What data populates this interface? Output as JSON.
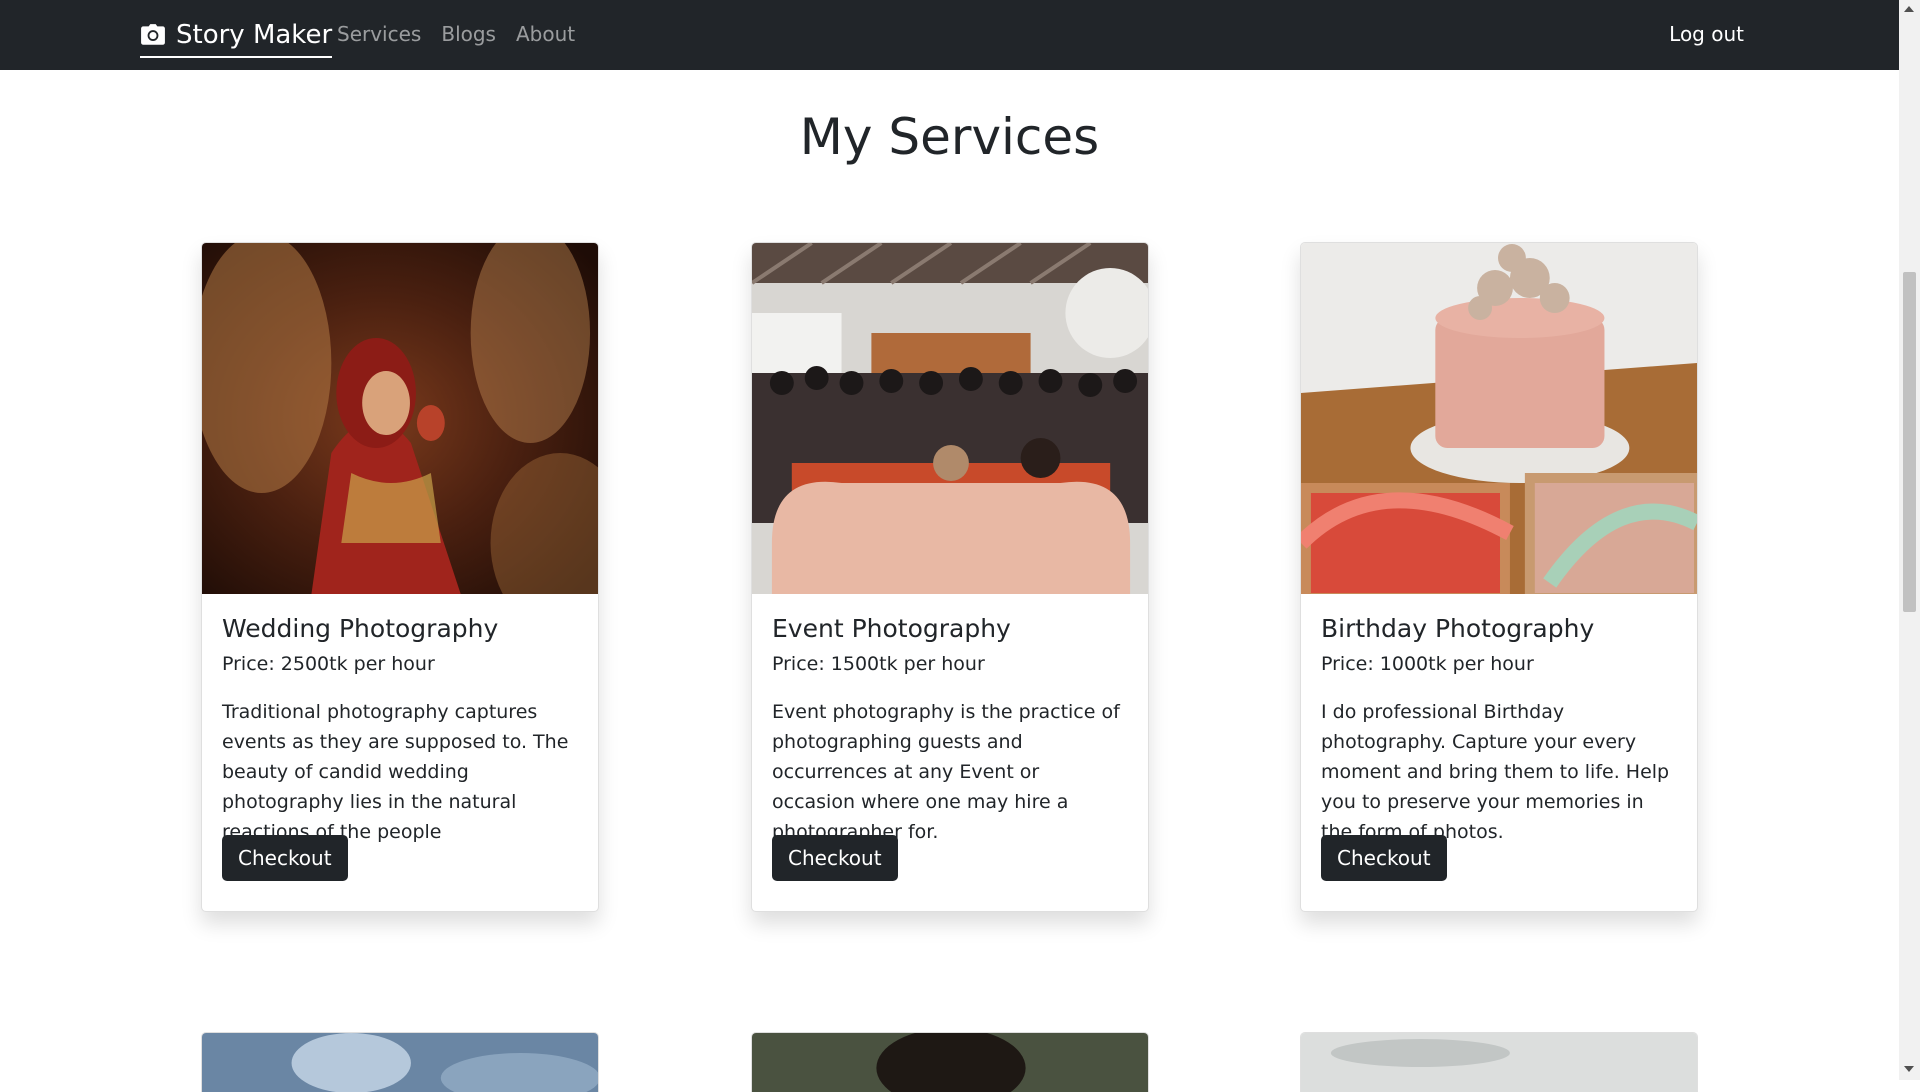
{
  "navbar": {
    "brand_label": "Story Maker",
    "brand_icon": "camera-icon",
    "links": [
      "Services",
      "Blogs",
      "About"
    ],
    "logout_label": "Log out"
  },
  "page": {
    "title": "My Services"
  },
  "services": [
    {
      "title": "Wedding Photography",
      "price": "Price: 2500tk per hour",
      "description": "Traditional photography captures events as they are supposed to. The beauty of candid wedding photography lies in the natural reactions of the people",
      "button": "Checkout"
    },
    {
      "title": "Event Photography",
      "price": "Price: 1500tk per hour",
      "description": "Event photography is the practice of photographing guests and occurrences at any Event or occasion where one may hire a photographer for.",
      "button": "Checkout"
    },
    {
      "title": "Birthday Photography",
      "price": "Price: 1000tk per hour",
      "description": "I do professional Birthday photography. Capture your every moment and bring them to life. Help you to preserve your memories in the form of photos.",
      "button": "Checkout"
    }
  ],
  "colors": {
    "navbar_bg": "#212529",
    "button_bg": "#212529",
    "nav_link": "rgba(255,255,255,0.55)"
  }
}
